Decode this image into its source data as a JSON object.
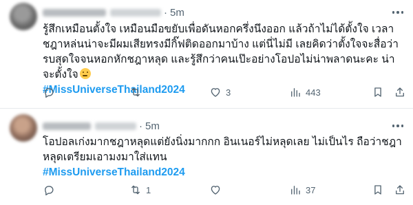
{
  "colors": {
    "hashtag": "#1d9bf0",
    "meta": "#536471",
    "text": "#0f1419"
  },
  "tweets": [
    {
      "time": "5m",
      "body": "รู้สึกเหมือนตั้งใจ เหมือนมือขยับเพื่อดันหอกครึ่งนึงออก แล้วถ้าไม่ได้ตั้งใจ เวลาชฎาหล่นน่าจะมีผมเสียทรงมีกิ๊ฟติดออกมาบ้าง แต่นี่ไม่มี เลยคิดว่าตั้งใจจะสื่อว่ารบสุดใจจนหอกหักชฎาหลุด และรู้สึกว่าคนเป๊ะอย่างโอปอไม่น่าพลาดนะคะ น่าจะตั้งใจ",
      "emoji_icon": "thinking-face-icon",
      "hashtag": "#MissUniverseThailand2024",
      "reply_count": "",
      "retweet_count": "",
      "like_count": "3",
      "view_count": "443"
    },
    {
      "time": "5m",
      "body": "โอปอลเก่งมากชฎาหลุดแต่ยังนิ่งมากกก อินเนอร์ไม่หลุดเลย ไม่เป็นไร ถือว่าชฎาหลุดเตรียมเอามงมาใส่แทน",
      "hashtag": "#MissUniverseThailand2024",
      "reply_count": "",
      "retweet_count": "1",
      "like_count": "",
      "view_count": "37"
    }
  ],
  "icons": {
    "reply": "reply-icon",
    "retweet": "retweet-icon",
    "like": "heart-icon",
    "views": "views-chart-icon",
    "bookmark": "bookmark-icon",
    "share": "share-icon",
    "more": "more-dots-icon"
  }
}
